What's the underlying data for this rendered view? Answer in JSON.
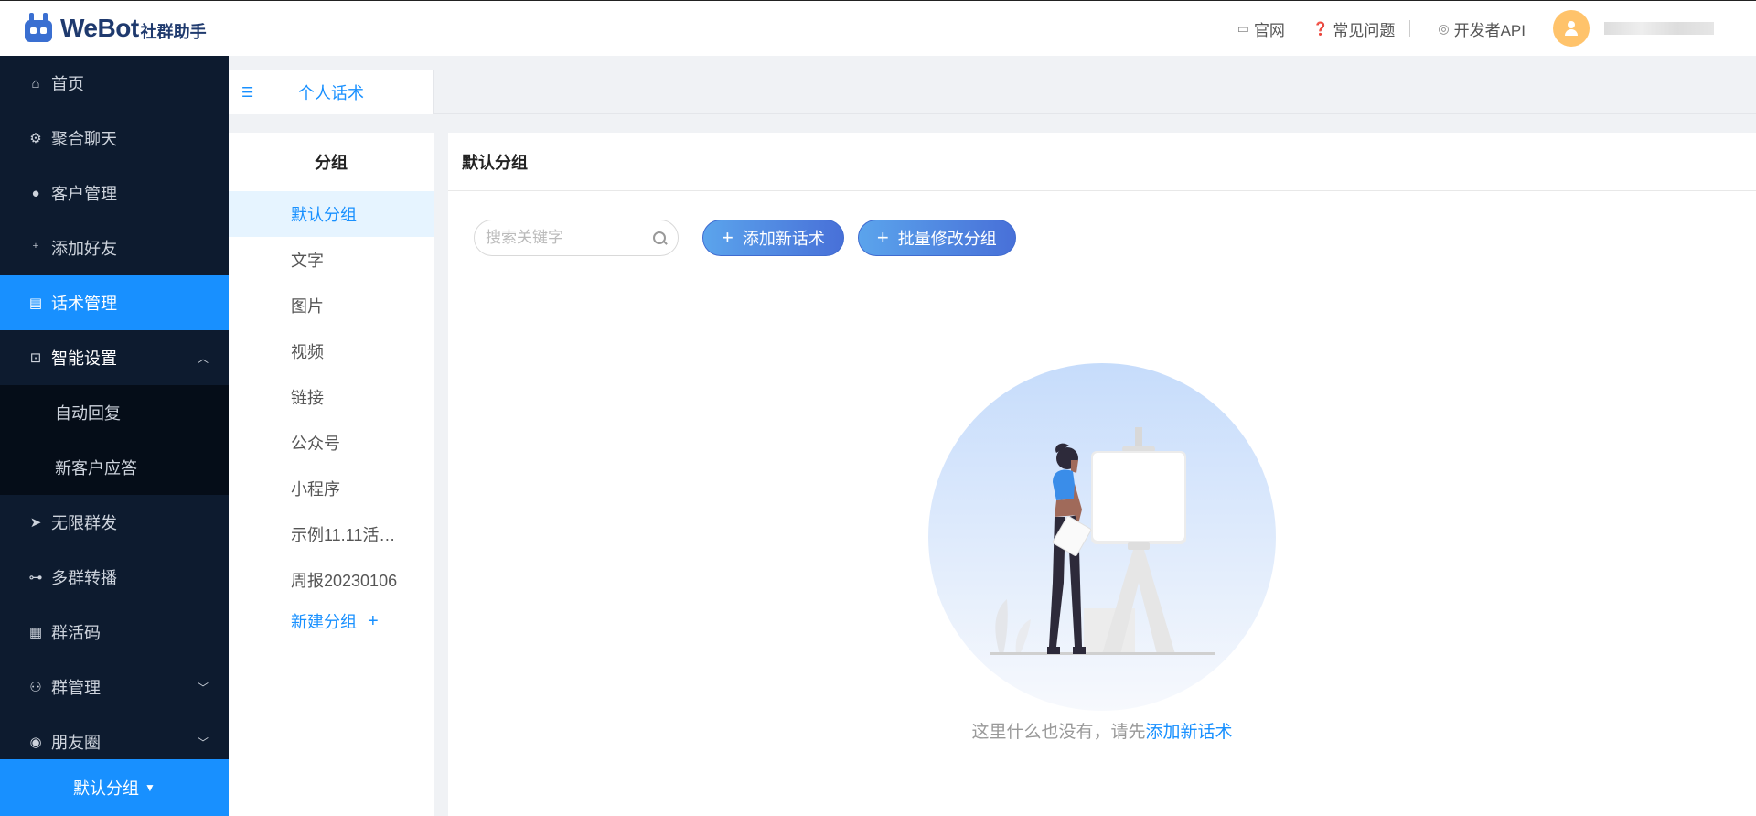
{
  "header": {
    "logo_text": "WeBot",
    "logo_sub": "社群助手",
    "links": [
      {
        "label": "官网",
        "icon": "monitor-icon"
      },
      {
        "label": "常见问题",
        "icon": "question-icon"
      },
      {
        "label": "开发者API",
        "icon": "api-icon"
      }
    ]
  },
  "sidebar": {
    "items": [
      {
        "label": "首页",
        "icon": "home-icon"
      },
      {
        "label": "聚合聊天",
        "icon": "gear-icon"
      },
      {
        "label": "客户管理",
        "icon": "user-icon"
      },
      {
        "label": "添加好友",
        "icon": "add-user-icon"
      },
      {
        "label": "话术管理",
        "icon": "document-icon",
        "active": true
      },
      {
        "label": "智能设置",
        "icon": "smart-icon",
        "expanded": true,
        "children": [
          {
            "label": "自动回复"
          },
          {
            "label": "新客户应答"
          }
        ]
      },
      {
        "label": "无限群发",
        "icon": "send-icon"
      },
      {
        "label": "多群转播",
        "icon": "broadcast-icon"
      },
      {
        "label": "群活码",
        "icon": "qrcode-icon"
      },
      {
        "label": "群管理",
        "icon": "group-icon"
      },
      {
        "label": "朋友圈",
        "icon": "moments-icon"
      }
    ],
    "bottom_label": "默认分组"
  },
  "tabs": [
    {
      "label": "个人话术"
    }
  ],
  "groups": {
    "title": "分组",
    "items": [
      "默认分组",
      "文字",
      "图片",
      "视频",
      "链接",
      "公众号",
      "小程序",
      "示例11.11活…",
      "周报20230106"
    ],
    "active_index": 0,
    "add_label": "新建分组"
  },
  "main": {
    "title": "默认分组",
    "search_placeholder": "搜索关键字",
    "add_button": "添加新话术",
    "batch_button": "批量修改分组",
    "empty_text": "这里什么也没有，请先",
    "empty_link": "添加新话术"
  },
  "colors": {
    "primary": "#1890ff",
    "sidebar_bg": "#0d1b2f",
    "button_gradient_start": "#5ba4ec",
    "button_gradient_end": "#4870d8"
  }
}
